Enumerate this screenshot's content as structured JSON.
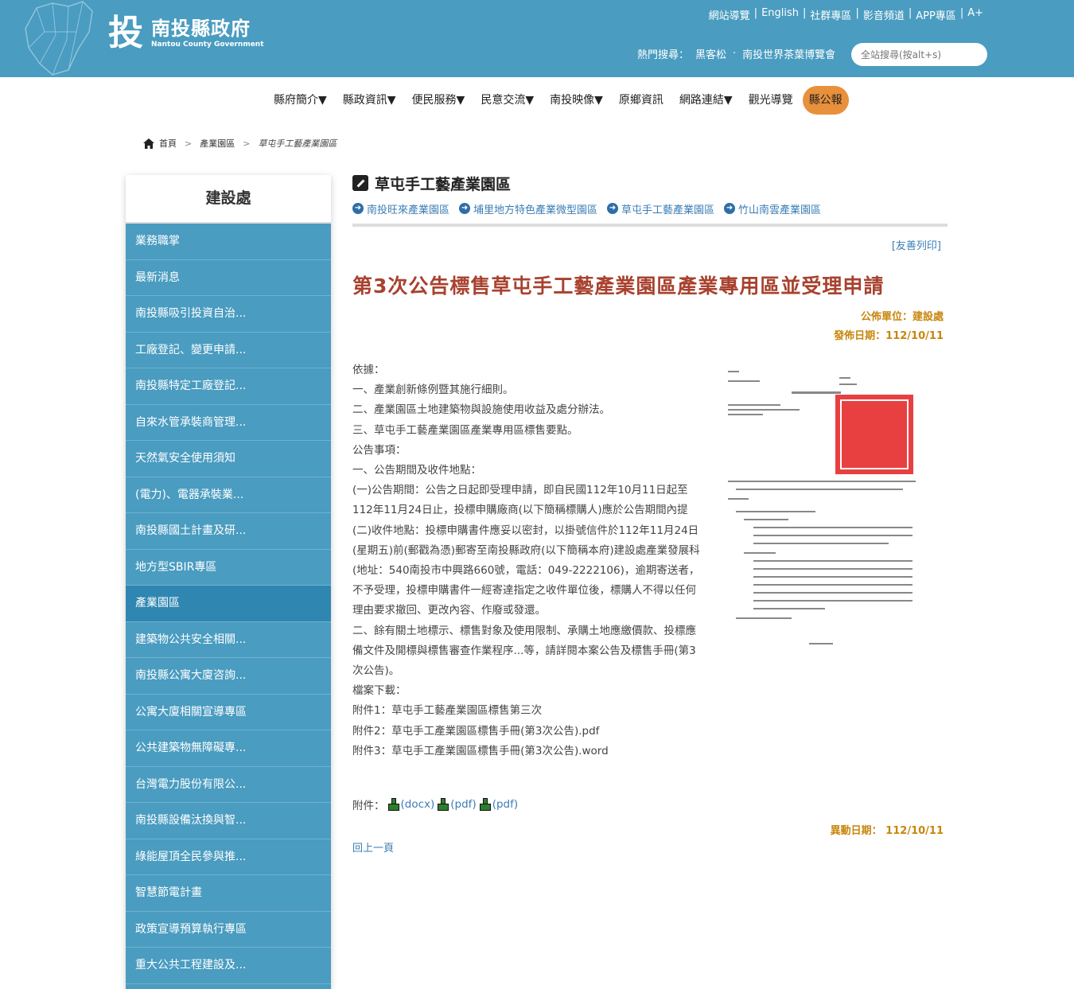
{
  "header": {
    "logo_mark": "投",
    "logo_cn": "南投縣政府",
    "logo_en": "Nantou County Government",
    "top_links": [
      "網站導覽",
      "English",
      "社群專區",
      "影音頻道",
      "APP專區",
      "A+"
    ],
    "hot_search_label": "熱門搜尋：",
    "hot_search_items": [
      "黑客松",
      "南投世界茶葉博覽會"
    ],
    "hot_search_sep": "·",
    "search_placeholder": "全站搜尋(按alt+s)"
  },
  "nav": {
    "items": [
      "縣府簡介▼",
      "縣政資訊▼",
      "便民服務▼",
      "民意交流▼",
      "南投映像▼",
      "原鄉資訊",
      "網路連結▼",
      "觀光導覽"
    ],
    "highlight": "縣公報"
  },
  "breadcrumb": {
    "home": "首頁",
    "level1": "產業園區",
    "current": "草屯手工藝產業園區",
    "sep": ">"
  },
  "sidebar": {
    "title": "建設處",
    "items": [
      "業務職掌",
      "最新消息",
      "南投縣吸引投資自治...",
      "工廠登記、變更申請...",
      "南投縣特定工廠登記...",
      "自來水管承裝商管理...",
      "天然氣安全使用須知",
      "(電力)、電器承裝業...",
      "南投縣國土計畫及研...",
      "地方型SBIR專區",
      "產業園區",
      "建築物公共安全相關...",
      "南投縣公寓大廈咨詢...",
      "公寓大廈相關宣導專區",
      "公共建築物無障礙專...",
      "台灣電力股份有限公...",
      "南投縣設備汰換與智...",
      "綠能屋頂全民參與推...",
      "智慧節電計畫",
      "政策宣導預算執行專區",
      "重大公共工程建設及..."
    ],
    "active_index": 10
  },
  "content": {
    "section_title": "草屯手工藝產業園區",
    "sublinks": [
      "南投旺來產業園區",
      "埔里地方特色產業微型園區",
      "草屯手工藝產業園區",
      "竹山南雲產業園區"
    ],
    "print": "[友善列印]",
    "headline": "第3次公告標售草屯手工藝產業園區產業專用區並受理申請",
    "pub_unit": "公佈單位：建設處",
    "pub_date": "發佈日期：112/10/11",
    "body": [
      "依據：",
      "一、產業創新條例暨其施行細則。",
      "二、產業園區土地建築物與設施使用收益及處分辦法。",
      "三、草屯手工藝產業園區產業專用區標售要點。",
      "公告事項：",
      "一、公告期間及收件地點：",
      "(一)公告期間：公告之日起即受理申請，即自民國112年10月11日起至112年11月24日止，投標申購廠商(以下簡稱標購人)應於公告期間內提",
      "(二)收件地點：投標申購書件應妥以密封，以掛號信件於112年11月24日(星期五)前(郵戳為憑)郵寄至南投縣政府(以下簡稱本府)建設處產業發展科(地址：540南投市中興路660號，電話：049-2222106)，逾期寄送者，不予受理，投標申購書件一經寄達指定之收件單位後，標購人不得以任何理由要求撤回、更改內容、作廢或發還。",
      "二、餘有關土地標示、標售對象及使用限制、承購土地應繳價款、投標應備文件及開標與標售審查作業程序...等，請詳閱本案公告及標售手冊(第3次公告)。",
      "檔案下載：",
      "附件1：草屯手工藝產業園區標售第三次",
      "附件2：草屯手工產業園區標售手冊(第3次公告).pdf",
      "附件3：草屯手工產業園區標售手冊(第3次公告).word"
    ],
    "attach_label": "附件：",
    "attachments": [
      "(docx)",
      "(pdf)",
      "(pdf)"
    ],
    "modified": "異動日期： 112/10/11",
    "back": "回上一頁"
  },
  "colors": {
    "header_bg": "#4a9cc0",
    "headline": "#a8422f",
    "meta": "#c8860c",
    "link": "#3a7db5",
    "nav_highlight": "#e8903b"
  }
}
